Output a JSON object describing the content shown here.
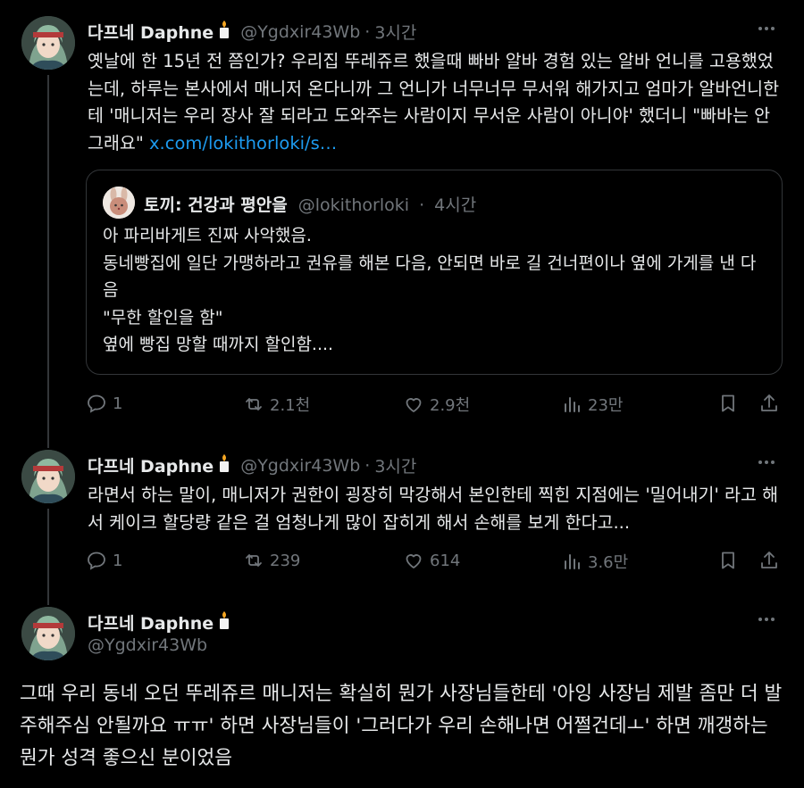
{
  "tweets": [
    {
      "name": "다프네 Daphne",
      "handle": "@Ygdxir43Wb",
      "time": "3시간",
      "text": "옛날에 한 15년 전 쯤인가? 우리집 뚜레쥬르 했을때 빠바 알바 경험 있는 알바 언니를 고용했었는데, 하루는 본사에서 매니저 온다니까 그 언니가 너무너무 무서워 해가지고 엄마가 알바언니한테 '매니저는 우리 장사 잘 되라고 도와주는 사람이지 무서운 사람이 아니야' 했더니 \"빠바는 안그래요\"",
      "link": "x.com/lokithorloki/s…",
      "quote": {
        "name": "토끼: 건강과 평안을",
        "handle": "@lokithorloki",
        "time": "4시간",
        "lines": [
          "아 파리바게트 진짜 사악했음.",
          "동네빵집에 일단 가맹하라고 권유를 해본 다음, 안되면 바로 길 건너편이나 옆에 가게를 낸 다음",
          "\"무한 할인을 함\"",
          "옆에 빵집 망할 때까지 할인함...."
        ]
      },
      "stats": {
        "replies": "1",
        "retweets": "2.1천",
        "likes": "2.9천",
        "views": "23만"
      }
    },
    {
      "name": "다프네 Daphne",
      "handle": "@Ygdxir43Wb",
      "time": "3시간",
      "text": "라면서 하는 말이, 매니저가 권한이 굉장히 막강해서 본인한테 찍힌 지점에는 '밀어내기' 라고 해서 케이크 할당량 같은 걸 엄청나게 많이 잡히게 해서 손해를 보게 한다고...",
      "stats": {
        "replies": "1",
        "retweets": "239",
        "likes": "614",
        "views": "3.6만"
      }
    },
    {
      "name": "다프네 Daphne",
      "handle": "@Ygdxir43Wb",
      "text": "그때 우리 동네 오던 뚜레쥬르 매니저는 확실히 뭔가 사장님들한테 '아잉 사장님 제발 좀만 더 발주해주심 안될까요 ㅠㅠ' 하면 사장님들이 '그러다가 우리 손해나면 어쩔건데ㅗ' 하면 깨갱하는 뭔가 성격 좋으신 분이었음"
    }
  ],
  "more_icon": "more-horizontal-icon",
  "colors": {
    "background": "#000000",
    "text": "#e7e9ea",
    "muted": "#71767b",
    "link": "#1d9bf0",
    "border": "#333639"
  }
}
